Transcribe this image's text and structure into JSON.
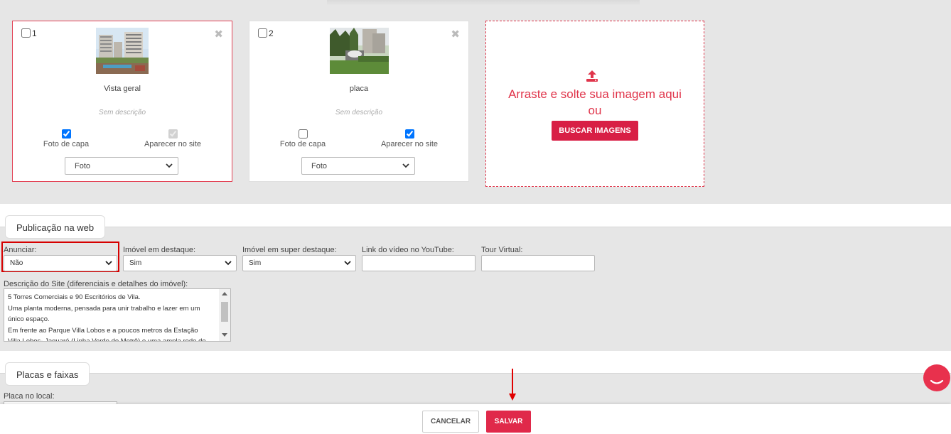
{
  "photos": [
    {
      "number": "1",
      "title": "Vista geral",
      "description": "Sem descrição",
      "cover_label": "Foto de capa",
      "cover_checked": true,
      "site_label": "Aparecer no site",
      "site_checked": true,
      "site_disabled": true,
      "type": "Foto",
      "selected": true,
      "thumbnail": "photo-buildings"
    },
    {
      "number": "2",
      "title": "placa",
      "description": "Sem descrição",
      "cover_label": "Foto de capa",
      "cover_checked": false,
      "site_label": "Aparecer no site",
      "site_checked": true,
      "site_disabled": false,
      "type": "Foto",
      "selected": false,
      "thumbnail": "photo-sign"
    }
  ],
  "upload": {
    "icon": "upload-icon",
    "text": "Arraste e solte sua imagem aqui ou",
    "button_label": "BUSCAR IMAGENS"
  },
  "web_publication": {
    "section_title": "Publicação na web",
    "anunciar_label": "Anunciar:",
    "anunciar_value": "Não",
    "destaque_label": "Imóvel em destaque:",
    "destaque_value": "Sim",
    "super_destaque_label": "Imóvel em super destaque:",
    "super_destaque_value": "Sim",
    "youtube_label": "Link do vídeo no YouTube:",
    "youtube_value": "",
    "tour_label": "Tour Virtual:",
    "tour_value": "",
    "description_label": "Descrição do Site (diferenciais e detalhes do imóvel):",
    "description_lines": [
      "5 Torres Comerciais e 90 Escritórios de Vila.",
      "Uma planta moderna, pensada para unir trabalho e lazer em um",
      "único espaço.",
      "Em frente ao Parque Villa Lobos e a poucos metros da Estação",
      "Villa Lobos- Jaguaré (Linha Verde do Metrô) e uma ampla rede de"
    ]
  },
  "signs": {
    "section_title": "Placas e faixas",
    "local_sign_label": "Placa no local:"
  },
  "footer": {
    "cancel_label": "CANCELAR",
    "save_label": "SALVAR"
  },
  "colors": {
    "accent": "#e0294a",
    "dropzone": "#e0354b",
    "highlight": "#d60000",
    "checkbox": "#1a73e8"
  }
}
